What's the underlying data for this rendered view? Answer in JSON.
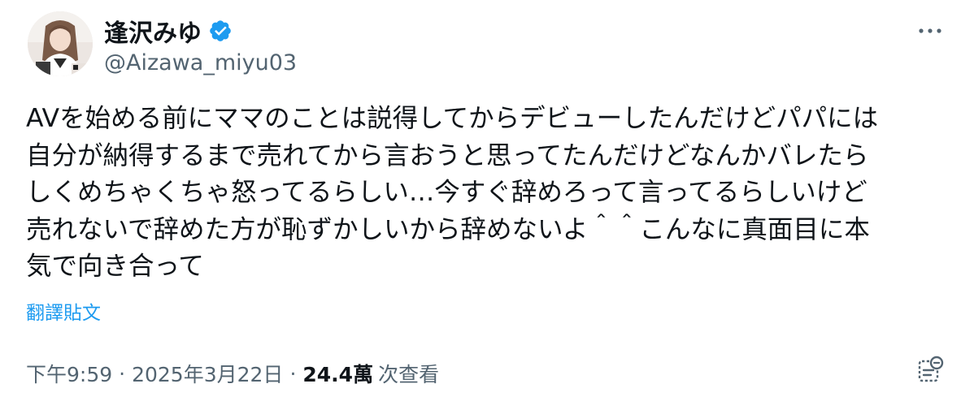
{
  "author": {
    "display_name": "逢沢みゆ",
    "handle": "@Aizawa_miyu03",
    "verified": true,
    "verified_color": "#1d9bf0"
  },
  "tweet": {
    "text_lines": [
      "AVを始める前にママのことは説得してからデビューしたんだけどパパには",
      "自分が納得するまで売れてから言おうと思ってたんだけどなんかバレたら",
      "しくめちゃくちゃ怒ってるらしい…今すぐ辞めろって言ってるらしいけど",
      "売れないで辞めた方が恥ずかしいから辞めないよ＾＾こんなに真面目に本",
      "気で向き合って"
    ],
    "translate_label": "翻譯貼文",
    "time": "下午9:59",
    "date": "2025年3月22日",
    "separator": "·",
    "views_count": "24.4萬",
    "views_label": "次查看"
  },
  "icons": {
    "more": "more-horizontal-icon",
    "verified": "verified-badge-icon",
    "grok": "grok-explain-icon"
  },
  "colors": {
    "text": "#0f1419",
    "secondary": "#536471",
    "accent": "#1d9bf0"
  }
}
